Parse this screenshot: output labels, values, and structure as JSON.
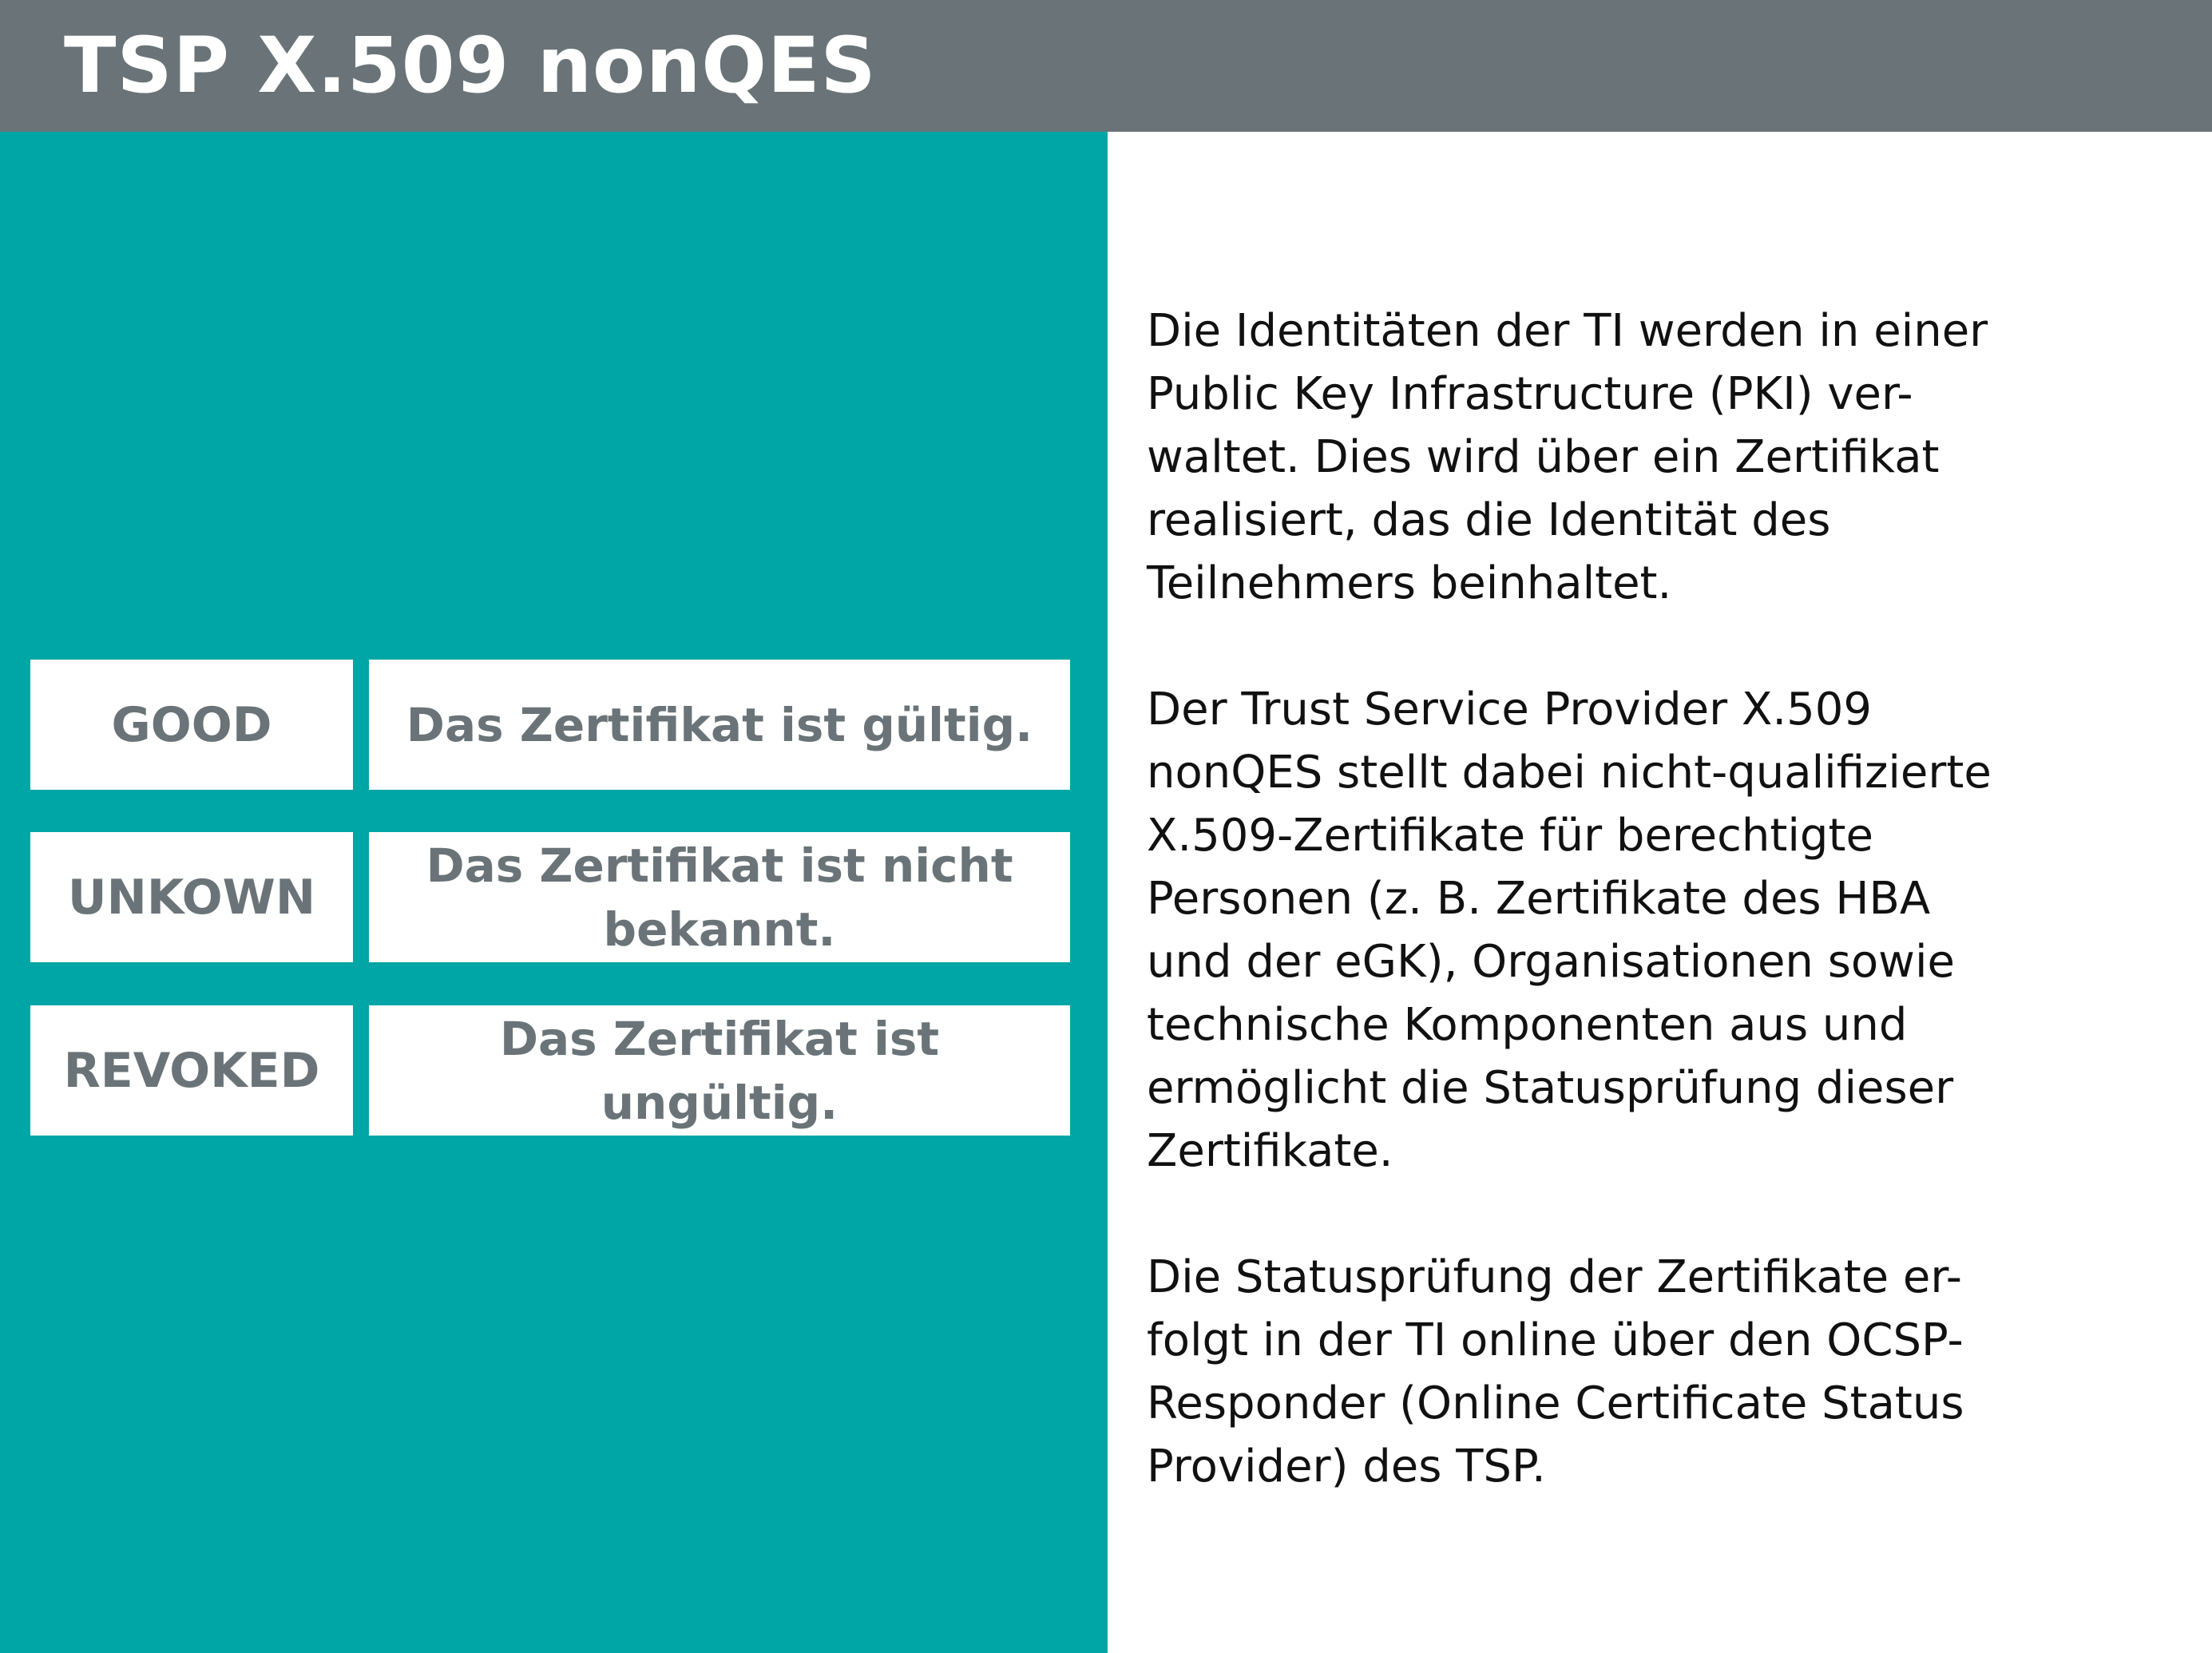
{
  "header": {
    "title": "TSP X.509 nonQES"
  },
  "statuses": [
    {
      "code": "GOOD",
      "description_lines": [
        "Das Zertifikat ist gültig."
      ]
    },
    {
      "code": "UNKOWN",
      "description_lines": [
        "Das Zertifikat ist nicht",
        "bekannt."
      ]
    },
    {
      "code": "REVOKED",
      "description_lines": [
        "Das Zertifikat ist",
        "ungültig."
      ]
    }
  ],
  "body": {
    "paragraphs": [
      {
        "lines": [
          "Die Identitäten der TI werden in einer",
          "Public Key Infrastructure (PKI) ver-",
          "waltet. Dies wird über ein Zertifikat",
          "realisiert, das die Identität des",
          "Teilnehmers beinhaltet."
        ]
      },
      {
        "lines": [
          "Der Trust Service Provider X.509",
          "nonQES stellt dabei nicht-qualifizierte",
          "X.509-Zertifikate für berechtigte",
          "Personen (z. B. Zertifikate des HBA",
          "und der eGK), Organisationen sowie",
          "technische Komponenten aus und",
          "ermöglicht die Statusprüfung dieser",
          "Zertifikate."
        ]
      },
      {
        "lines": [
          "Die Statusprüfung der Zertifikate er-",
          "folgt in der TI online über den OCSP-",
          "Responder (Online Certificate Status",
          "Provider) des TSP."
        ]
      }
    ]
  },
  "colors": {
    "header_background": "#6a7478",
    "panel_background": "#00a6a5",
    "box_text": "#6a7478",
    "box_background": "#ffffff",
    "body_text": "#111111"
  }
}
